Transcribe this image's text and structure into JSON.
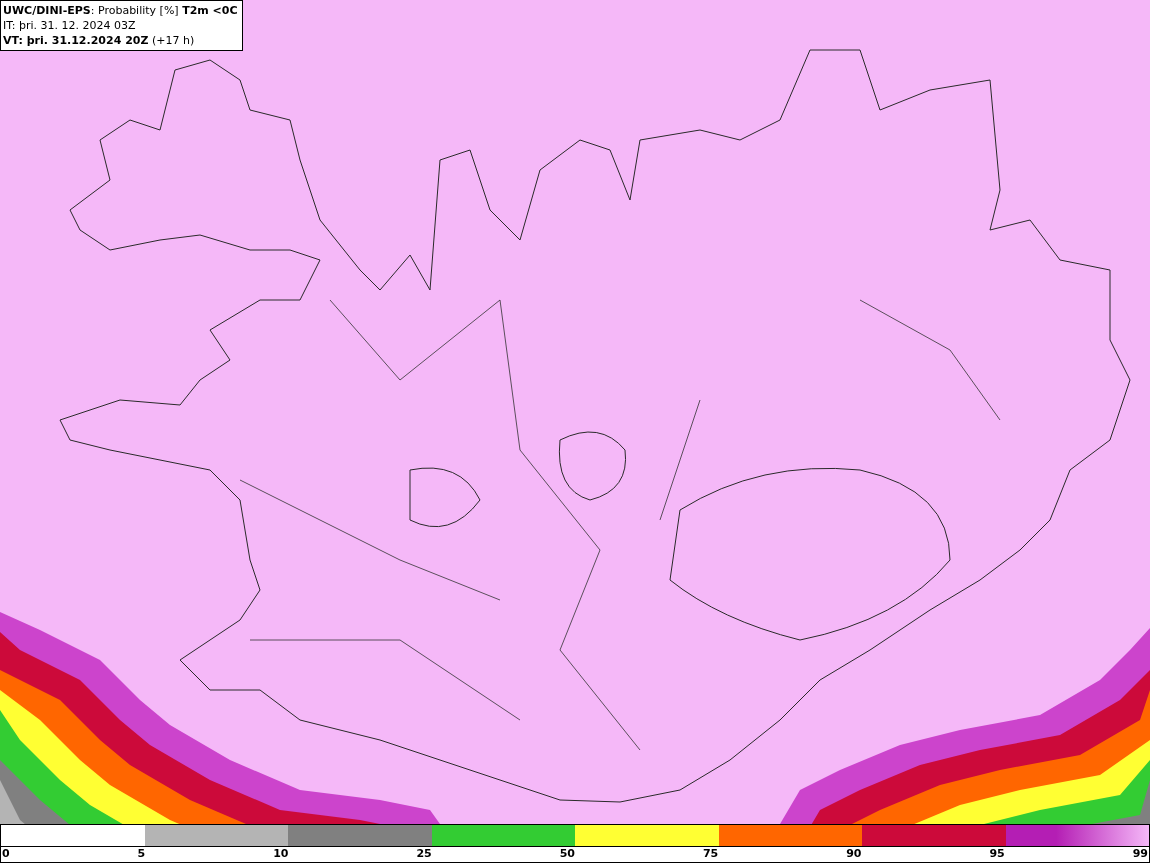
{
  "title_box": {
    "lines": [
      "**UWC/DINI-EPS**: Probability [%] **T2m <0C**",
      "IT: þri. 31. 12. 2024 03Z",
      "**VT: þri. 31.12.2024 20Z** (+17 h)"
    ]
  },
  "legend": {
    "segments": [
      {
        "color": "#ffffff"
      },
      {
        "color": "#b4b4b4"
      },
      {
        "color": "#808080"
      },
      {
        "color": "#33cc33"
      },
      {
        "color": "#ffff33"
      },
      {
        "color": "#ff6600"
      },
      {
        "color": "#cc0a3a"
      },
      {
        "color": "#b41eb4"
      }
    ],
    "labels": [
      "0",
      "5",
      "10",
      "25",
      "50",
      "75",
      "90",
      "95",
      "99"
    ]
  }
}
